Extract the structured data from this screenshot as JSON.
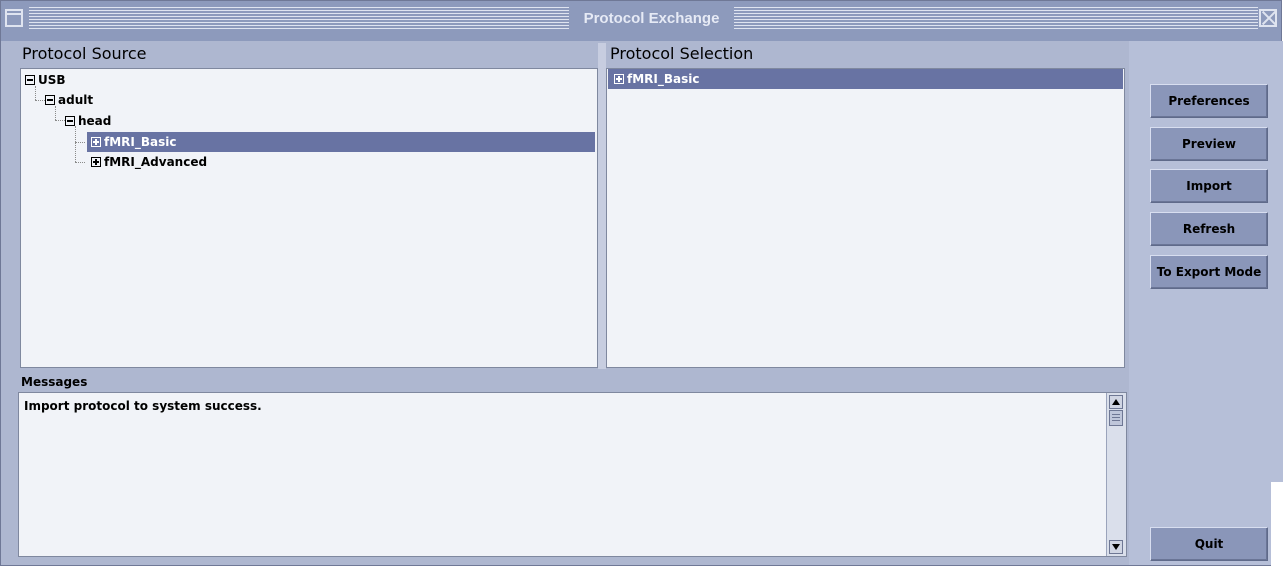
{
  "window": {
    "title": "Protocol Exchange",
    "minimize_icon": "window-menu-icon",
    "close_icon": "close-icon"
  },
  "protocol_source": {
    "title": "Protocol Source",
    "tree": [
      {
        "label": "USB",
        "expanded": true,
        "level": 0
      },
      {
        "label": "adult",
        "expanded": true,
        "level": 1
      },
      {
        "label": "head",
        "expanded": true,
        "level": 2
      },
      {
        "label": "fMRI_Basic",
        "expanded": false,
        "level": 3,
        "selected": true
      },
      {
        "label": "fMRI_Advanced",
        "expanded": false,
        "level": 3
      }
    ]
  },
  "protocol_selection": {
    "title": "Protocol Selection",
    "items": [
      {
        "label": "fMRI_Basic",
        "expanded": false,
        "selected": true
      }
    ]
  },
  "messages": {
    "title": "Messages",
    "text": "Import protocol to system success."
  },
  "buttons": {
    "preferences": "Preferences",
    "preview": "Preview",
    "import": "Import",
    "refresh": "Refresh",
    "export_mode": "To Export Mode",
    "quit": "Quit"
  },
  "colors": {
    "window_bg": "#aeb7d0",
    "titlebar": "#8d9abc",
    "selection": "#6873a3",
    "button": "#8a96b9",
    "list_bg": "#f1f3f8"
  }
}
